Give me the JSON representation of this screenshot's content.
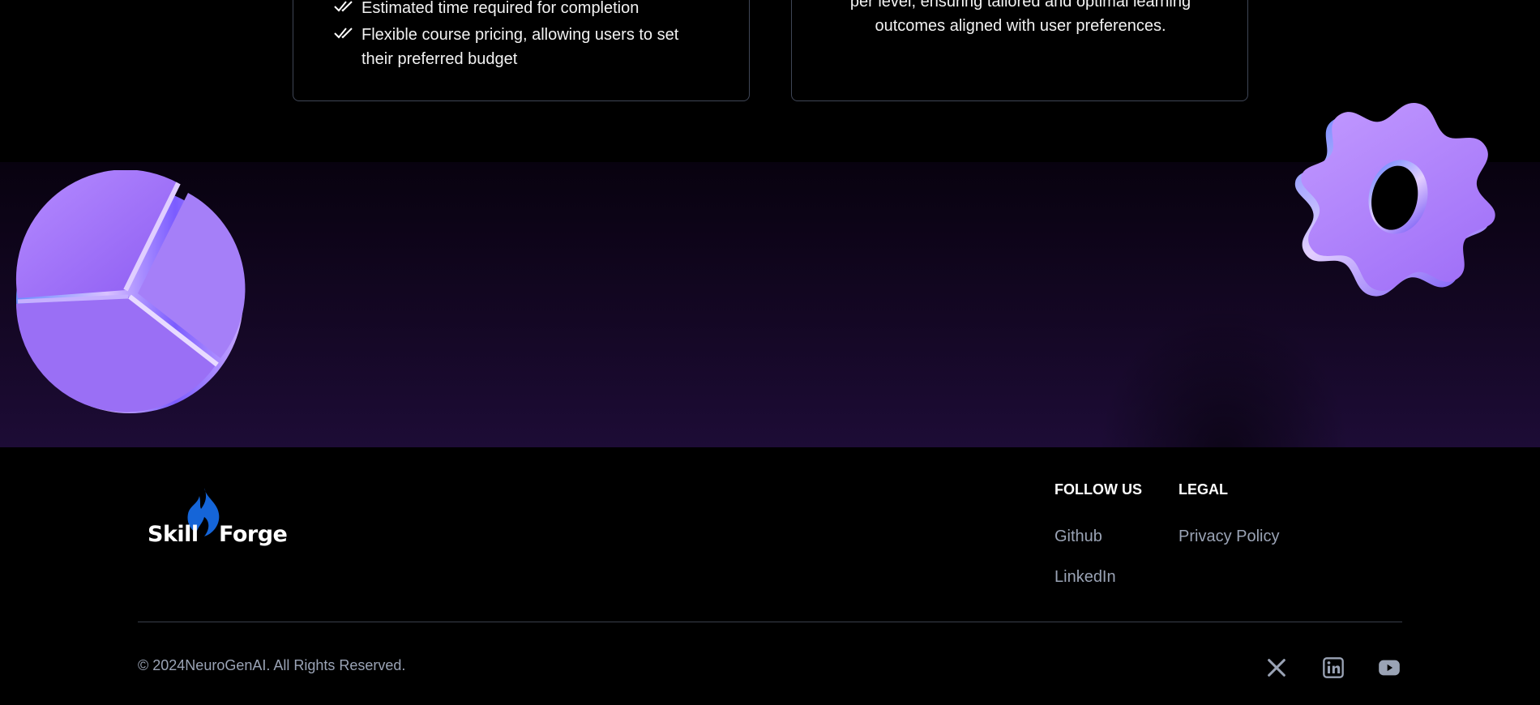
{
  "features_left": {
    "items": [
      "Estimated time required for completion",
      "Flexible course pricing, allowing users to set their preferred budget"
    ]
  },
  "features_right": {
    "lines": [
      "per level, ensuring tailored and optimal learning",
      "outcomes aligned with user preferences."
    ]
  },
  "footer": {
    "logo": {
      "word1": "Skill",
      "word2": "Forge",
      "flame_color": "#1565d8"
    },
    "follow_us": {
      "heading": "FOLLOW US",
      "links": [
        "Github",
        "LinkedIn"
      ]
    },
    "legal": {
      "heading": "LEGAL",
      "links": [
        "Privacy Policy"
      ]
    },
    "copyright": "© 2024NeuroGenAI. All Rights Reserved.",
    "social_icons": [
      "x-icon",
      "linkedin-icon",
      "youtube-icon"
    ]
  },
  "colors": {
    "background": "#000000",
    "band_bottom": "#1d0c36",
    "accent_purple": "#a77bff",
    "muted_text": "#9aa3b5",
    "card_border": "#3f4656"
  }
}
